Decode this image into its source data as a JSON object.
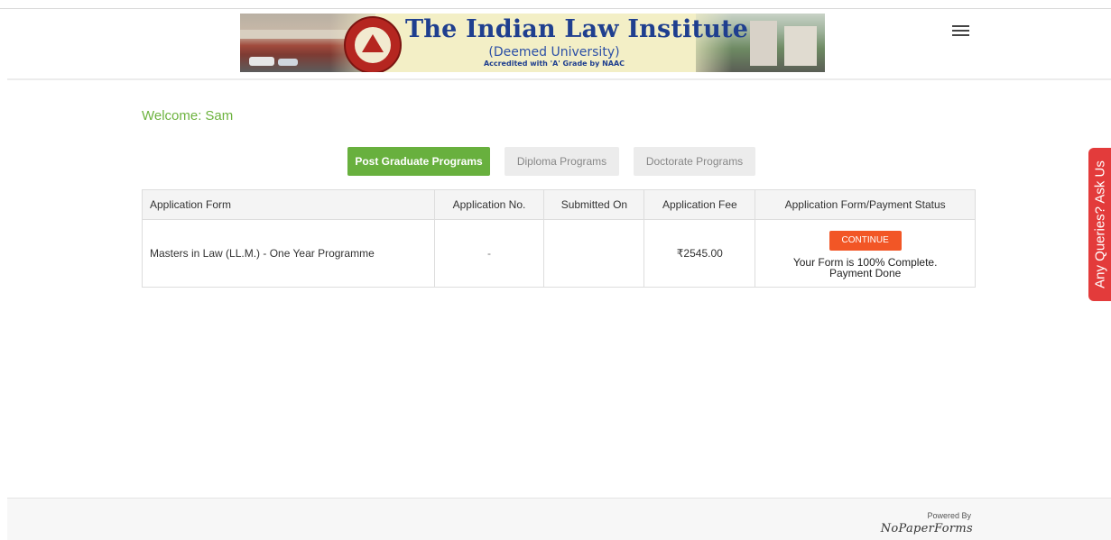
{
  "header": {
    "logo_title": "The Indian Law Institute",
    "logo_subtitle": "(Deemed University)",
    "logo_accreditation": "Accredited with 'A' Grade by NAAC",
    "menu_icon": "hamburger-menu-icon"
  },
  "welcome": {
    "label": "Welcome:",
    "name": "Sam"
  },
  "tabs": [
    {
      "label": "Post Graduate Programs",
      "active": true
    },
    {
      "label": "Diploma Programs",
      "active": false
    },
    {
      "label": "Doctorate Programs",
      "active": false
    }
  ],
  "table": {
    "headers": [
      "Application Form",
      "Application No.",
      "Submitted On",
      "Application Fee",
      "Application Form/Payment Status"
    ],
    "rows": [
      {
        "form": "Masters in Law (LL.M.) - One Year Programme",
        "application_no": "-",
        "submitted_on": "",
        "fee": "₹2545.00",
        "action_label": "CONTINUE",
        "status_line1": "Your Form is 100% Complete.",
        "status_line2": "Payment Done"
      }
    ]
  },
  "side_tab": {
    "label": "Any Queries? Ask Us"
  },
  "footer": {
    "powered_by": "Powered By",
    "brand": "NoPaperForms"
  },
  "colors": {
    "accent_green": "#68b03e",
    "welcome_green": "#6db33f",
    "continue_orange": "#f25626",
    "ask_red": "#e33b3b",
    "logo_blue": "#1f3f8f"
  }
}
